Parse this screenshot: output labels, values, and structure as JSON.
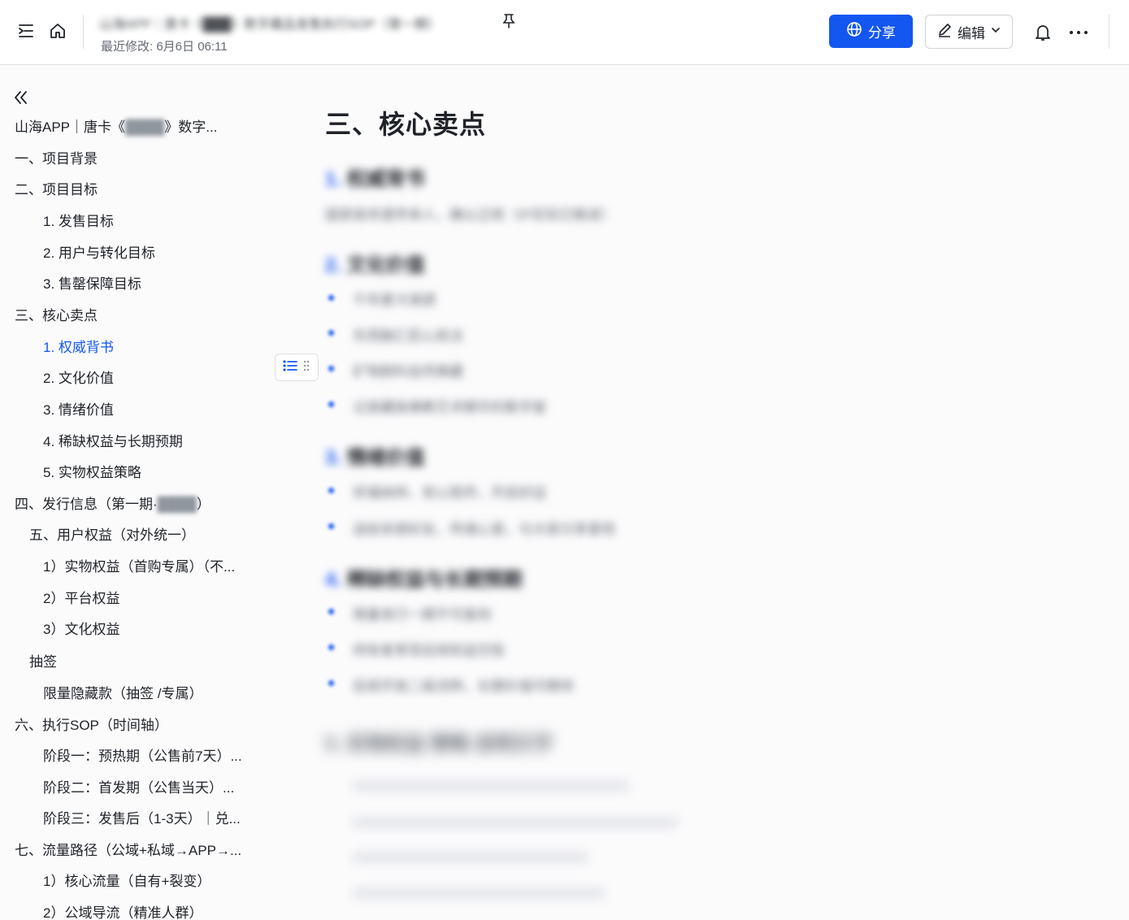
{
  "header": {
    "doc_title": "山海APP｜唐卡《███》数字藏品发售执行SOP（第一期）",
    "last_modified": "最近修改: 6月6日 06:11",
    "share_label": "分享",
    "edit_label": "编辑"
  },
  "toc": {
    "root_prefix": "山海APP｜唐卡《",
    "root_hidden": "████",
    "root_suffix": "》数字...",
    "items": [
      "一、项目背景",
      "二、项目目标",
      "1. 发售目标",
      "2. 用户与转化目标",
      "3. 售罄保障目标",
      "三、核心卖点",
      "1. 权威背书",
      "2. 文化价值",
      "3. 情绪价值",
      "4. 稀缺权益与长期预期",
      "5. 实物权益策略",
      "四、发行信息（第一期·",
      "五、用户权益（对外统一）",
      "1）实物权益（首购专属）（不...",
      "2）平台权益",
      "3）文化权益",
      "抽签",
      "限量隐藏款（抽签 /专属）",
      "六、执行SOP（时间轴）",
      "阶段一：预热期（公售前7天）...",
      "阶段二：首发期（公售当天）...",
      "阶段三：发售后（1-3天）｜兑...",
      "七、流量路径（公域+私域→APP→...",
      "1）核心流量（自有+裂变）",
      "2）公域导流（精准人群）"
    ],
    "item4_hidden": "████",
    "item4_suffix": "）"
  },
  "content": {
    "h1": "三、核心卖点",
    "sec1_num": "1.",
    "sec1_title": "权威背书",
    "sec1_text": "国家级非遗传承人，确认正统（IP实际已推进）",
    "sec2_num": "2.",
    "sec2_title": "文化价值",
    "sec2_bullets": [
      "千年唐卡渊源",
      "东西融汇匠心技法",
      "矿物颜料自然典藏",
      "记录藏族佛教艺术精华的数字窗"
    ],
    "sec3_num": "3.",
    "sec3_title": "情绪价值",
    "sec3_bullets": [
      "祈福纳祥，安心陪伴，开启好运",
      "送给亲朋好友，传递心意，与大家分享喜悦"
    ],
    "sec4_num": "4.",
    "sec4_title": "稀缺权益与长期预期",
    "sec4_bullets": [
      "限量发行一期不可复刻",
      "持有者享受后续权益空投",
      "后续开放二级流转，长期价值可期待"
    ],
    "sec5_num": "5.",
    "sec5_title": "实物权益 策略 说明文字"
  }
}
